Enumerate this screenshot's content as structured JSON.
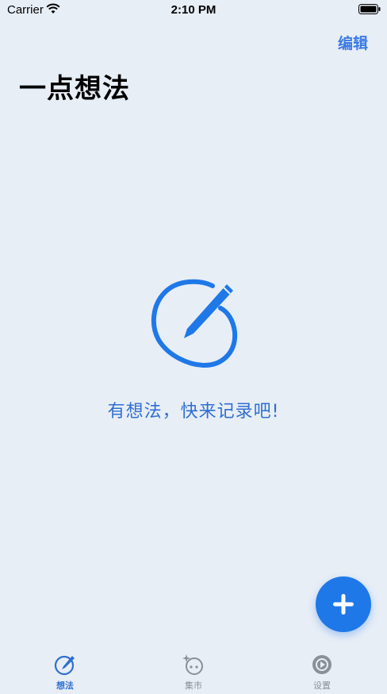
{
  "status_bar": {
    "carrier": "Carrier",
    "time": "2:10 PM"
  },
  "header": {
    "edit_label": "编辑",
    "title": "一点想法"
  },
  "empty_state": {
    "icon": "pencil-circle-icon",
    "message": "有想法，快来记录吧!"
  },
  "fab": {
    "icon": "plus-icon"
  },
  "tab_bar": {
    "tabs": [
      {
        "label": "想法",
        "icon": "pencil-circle-icon",
        "active": true
      },
      {
        "label": "集市",
        "icon": "sparkle-circle-icon",
        "active": false
      },
      {
        "label": "设置",
        "icon": "gear-circle-icon",
        "active": false
      }
    ]
  },
  "colors": {
    "background": "#e8eef6",
    "accent": "#1f78e8",
    "accent_text": "#2f6fd0",
    "inactive": "#8a8f99"
  }
}
